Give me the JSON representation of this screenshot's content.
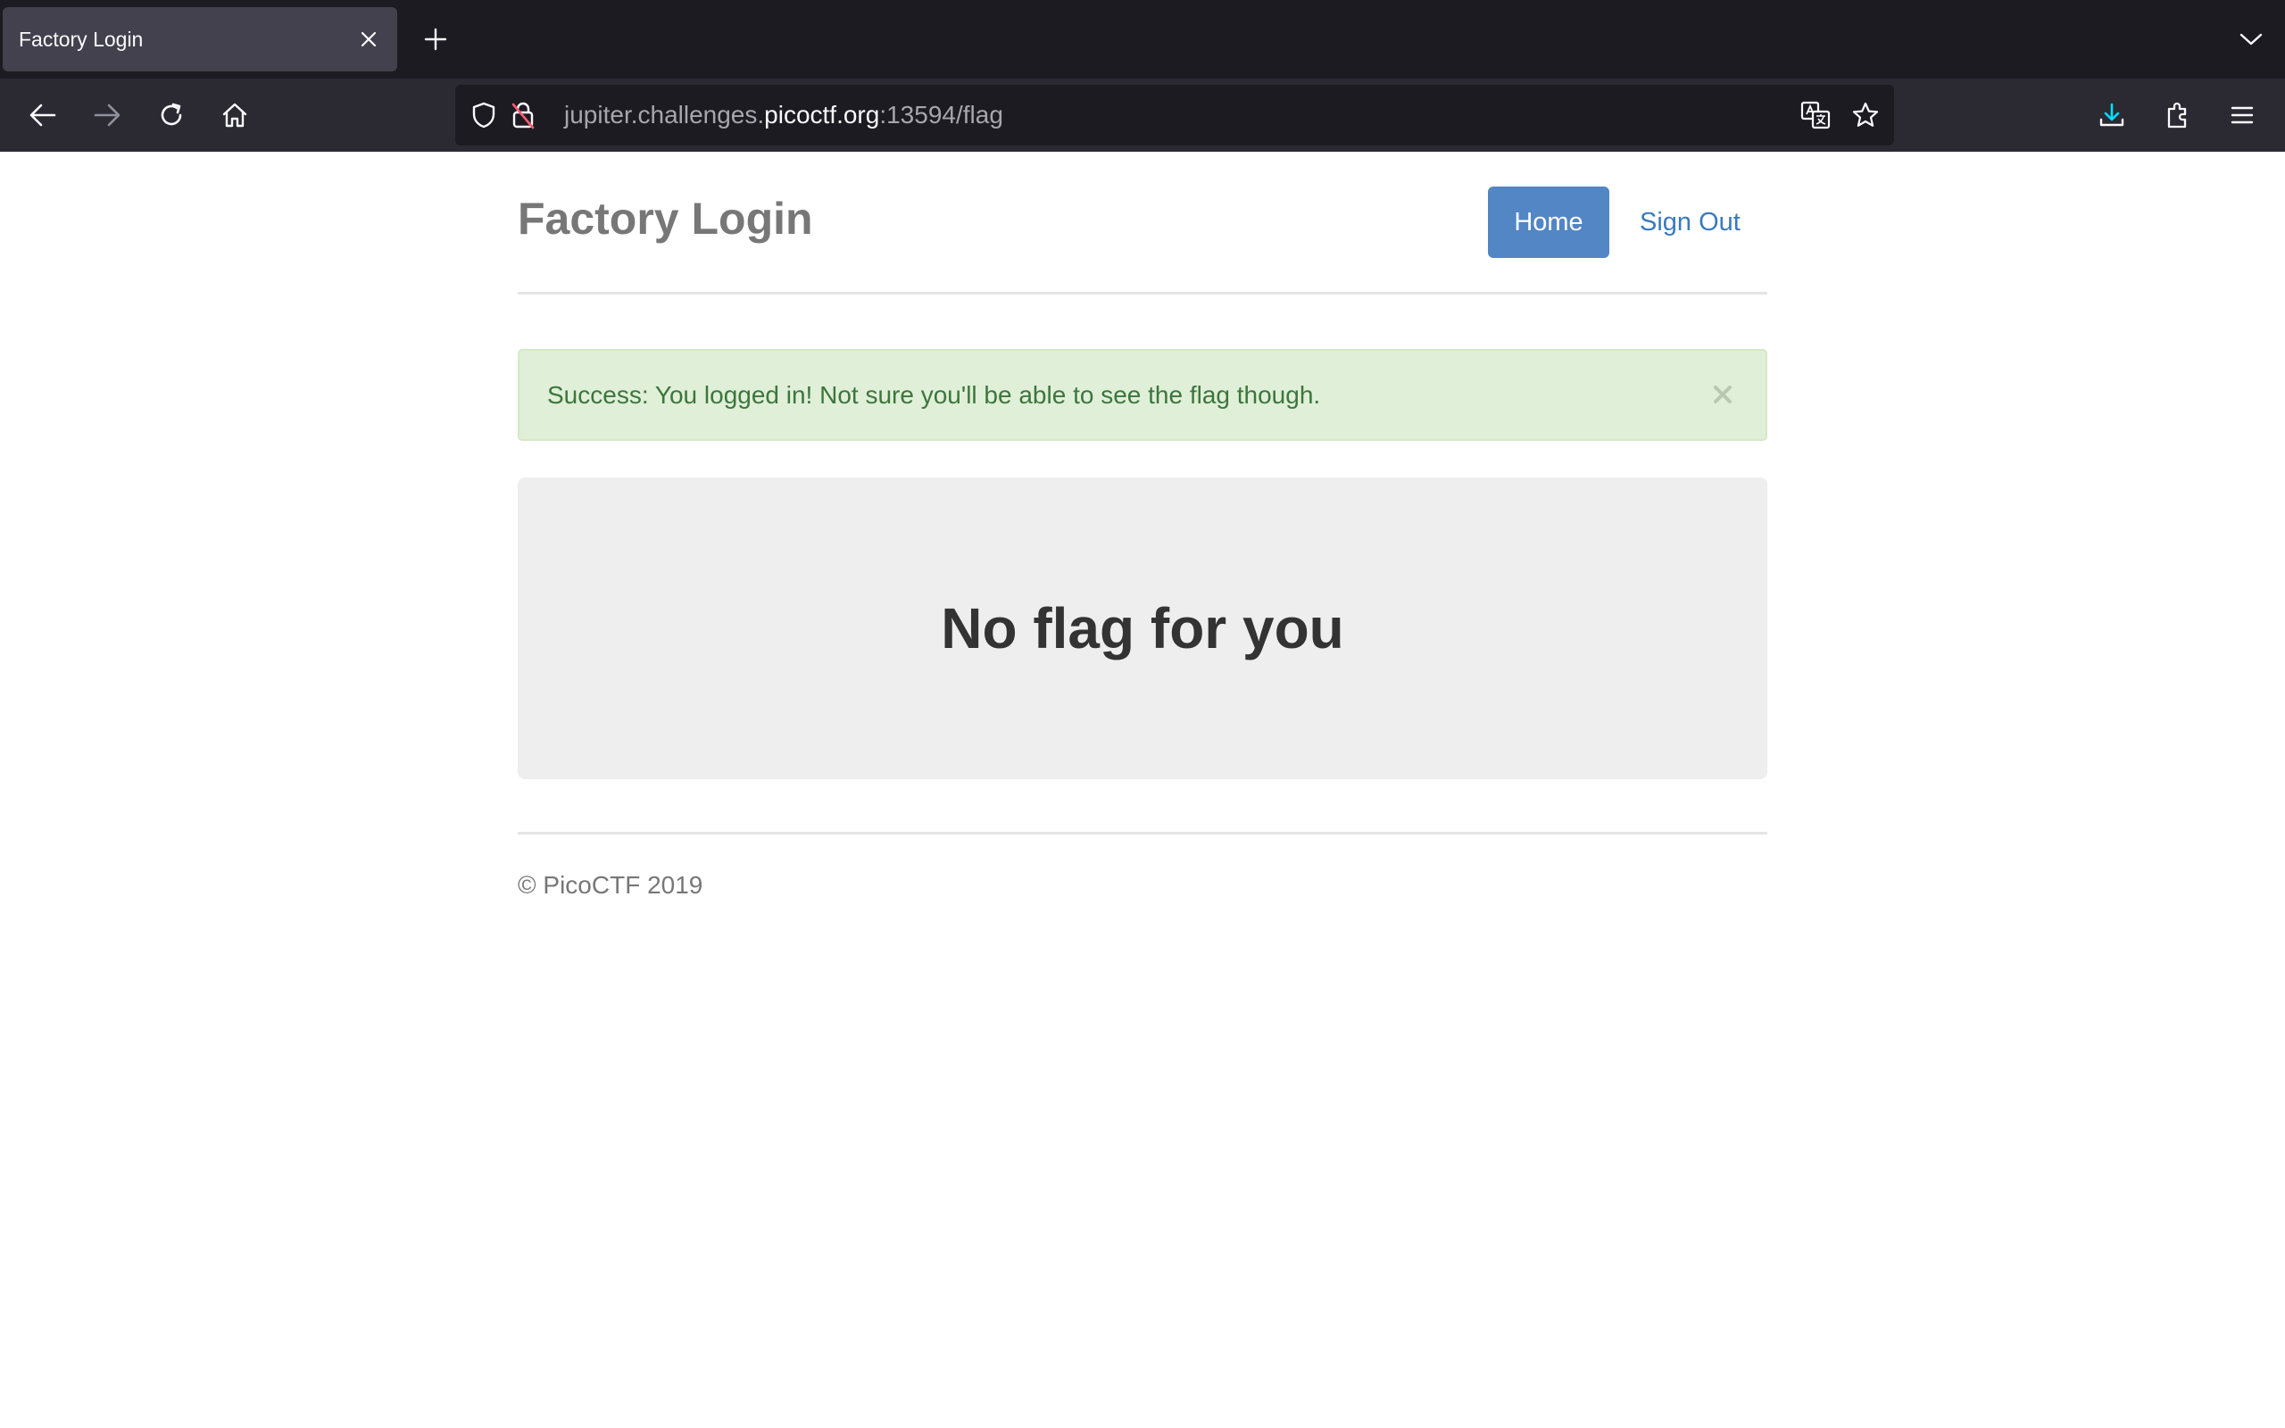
{
  "browser": {
    "tab": {
      "title": "Factory Login"
    },
    "url": {
      "prefix": "jupiter.challenges.",
      "host": "picoctf.org",
      "suffix": ":13594/flag"
    }
  },
  "page": {
    "brand": "Factory Login",
    "nav": {
      "home_label": "Home",
      "signout_label": "Sign Out"
    },
    "alert": {
      "text": "Success: You logged in! Not sure you'll be able to see the flag though.",
      "close_glyph": "×"
    },
    "jumbotron": {
      "title": "No flag for you"
    },
    "footer": {
      "text": "© PicoCTF 2019"
    }
  },
  "colors": {
    "primary": "#5286c4",
    "link": "#3a7abf",
    "alert_bg": "#e0efd8",
    "alert_text": "#3c763d",
    "jumbotron_bg": "#eeeeee"
  }
}
